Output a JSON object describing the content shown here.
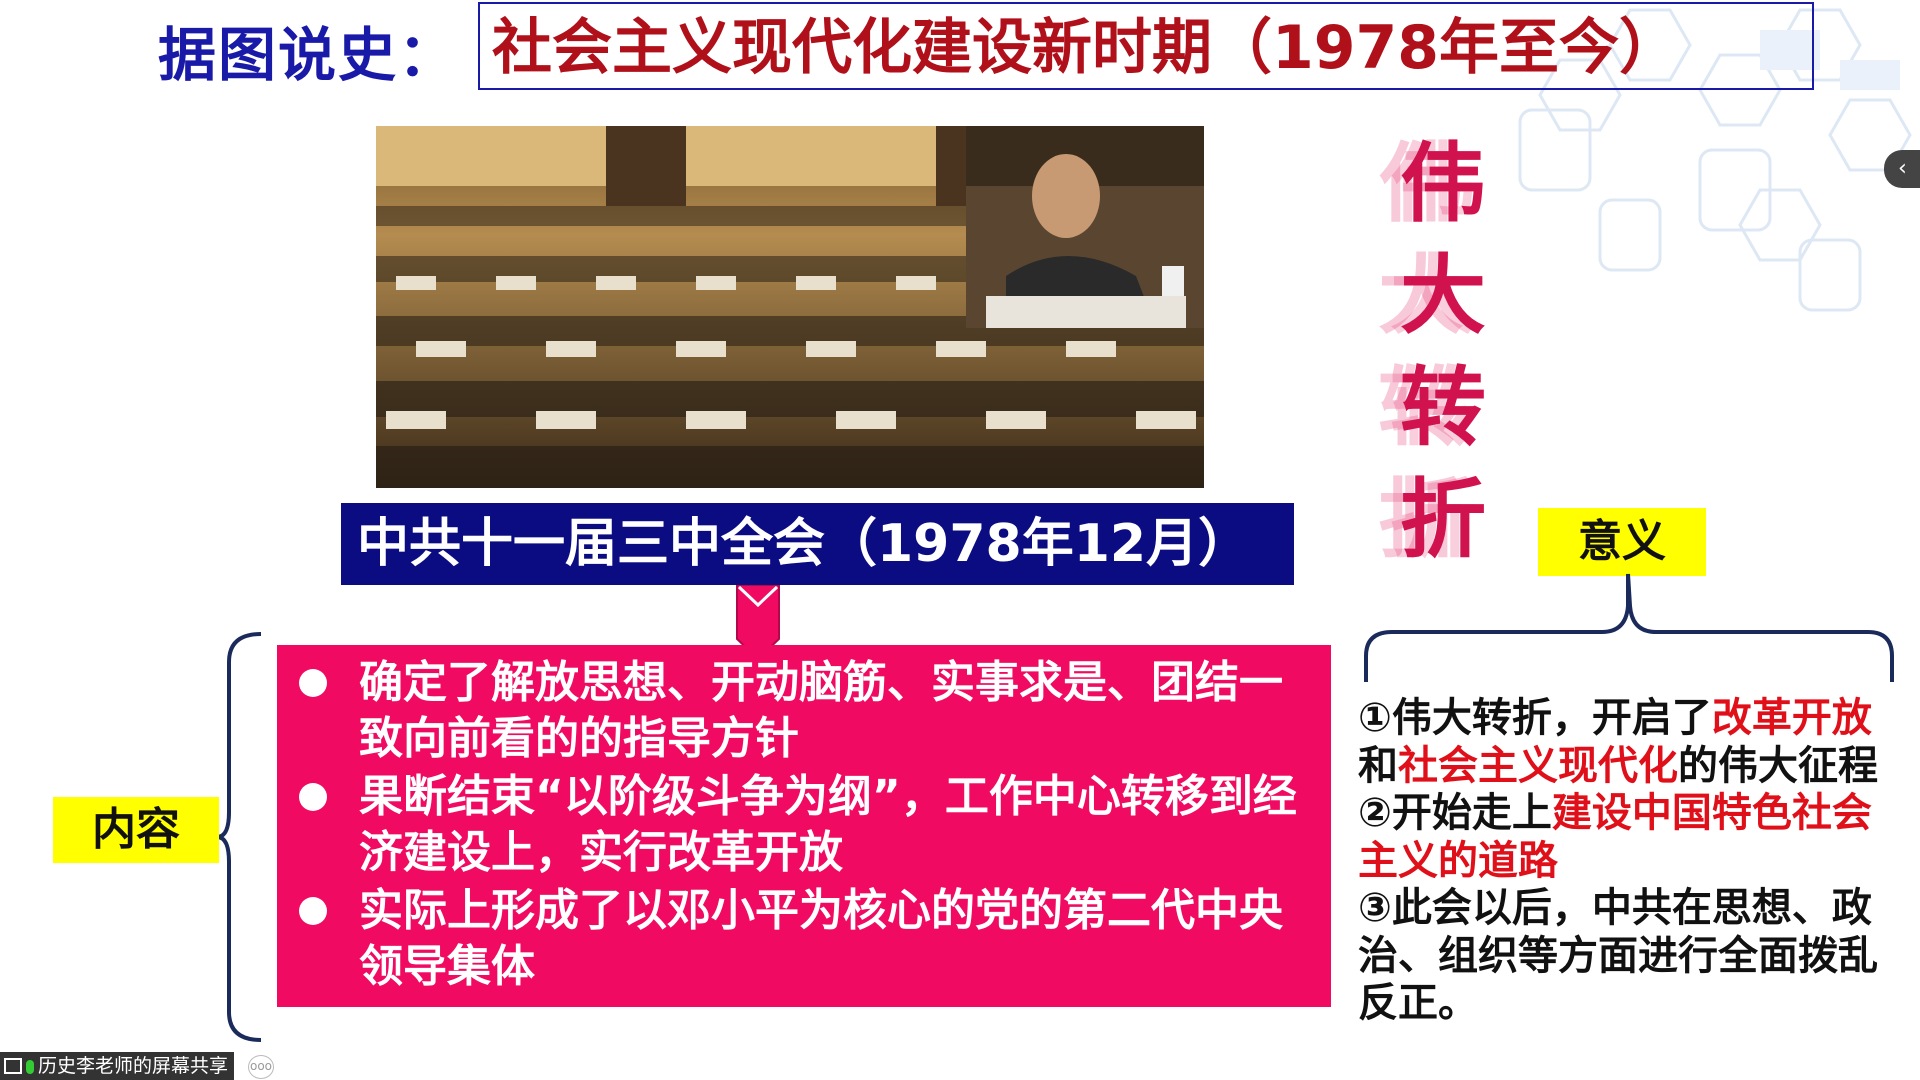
{
  "title": {
    "prefix": "据图说史：",
    "main": "社会主义现代化建设新时期（1978年至今）"
  },
  "photo": {
    "description_icon": "meeting-photo"
  },
  "banner": "中共十一届三中全会（1978年12月）",
  "content_label": "内容",
  "content_items": [
    "确定了解放思想、开动脑筋、实事求是、团结一致向前看的的指导方针",
    "果断结束“以阶级斗争为纲”，工作中心转移到经济建设上，实行改革开放",
    "实际上形成了以邓小平为核心的党的第二代中央领导集体"
  ],
  "vertical_title": [
    "伟",
    "大",
    "转",
    "折"
  ],
  "significance_label": "意义",
  "significance": {
    "p1_a": "①伟大转折，开启了",
    "p1_red1": "改革开放",
    "p1_b": "和",
    "p1_red2": "社会主义现代化",
    "p1_c": "的伟大征程",
    "p2_a": "②开始走上",
    "p2_red": "建设中国特色社会主义的道路",
    "p3": "③此会以后，中共在思想、政治、组织等方面进行全面拨乱反正。"
  },
  "side_tab": "‹",
  "share_label": "历史李老师的屏幕共享",
  "share_more": "ooo",
  "colors": {
    "title_blue": "#1a1aa8",
    "title_red": "#b0101a",
    "banner_navy": "#0c0c82",
    "content_pink": "#f00a62",
    "label_yellow": "#ffff00",
    "accent_red": "#e0101a"
  }
}
